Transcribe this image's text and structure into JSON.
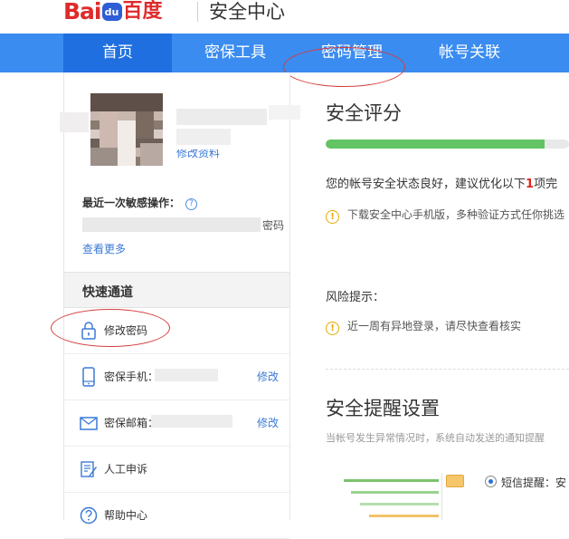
{
  "header": {
    "logo_bai": "Bai",
    "logo_du": "du",
    "logo_cn": "百度",
    "title": "安全中心"
  },
  "nav": {
    "items": [
      {
        "label": "首页",
        "active": true
      },
      {
        "label": "密保工具",
        "active": false
      },
      {
        "label": "密码管理",
        "active": false
      },
      {
        "label": "帐号关联",
        "active": false
      }
    ]
  },
  "sidebar": {
    "edit_profile": "修改资料",
    "recent_label": "最近一次敏感操作：",
    "recent_tail": "密码",
    "see_more": "查看更多",
    "quick_title": "快速通道",
    "items": [
      {
        "icon": "lock-icon",
        "label": "修改密码"
      },
      {
        "icon": "phone-icon",
        "label": "密保手机：",
        "action": "修改"
      },
      {
        "icon": "mail-icon",
        "label": "密保邮箱：",
        "action": "修改"
      },
      {
        "icon": "appeal-icon",
        "label": "人工申诉"
      },
      {
        "icon": "help-icon",
        "label": "帮助中心"
      }
    ]
  },
  "main": {
    "score_title": "安全评分",
    "score_progress": 0.9,
    "status_prefix": "您的帐号安全状态良好，建议优化以下",
    "status_count": "1",
    "status_suffix": "项完",
    "tip_download": "下载安全中心手机版，多种验证方式任你挑选",
    "risk_label": "风险提示：",
    "tip_risk": "近一周有异地登录，请尽快查看核实",
    "remind_title": "安全提醒设置",
    "remind_sub": "当帐号发生异常情况时，系统自动发送的通知提醒",
    "sms_label": "短信提醒：安"
  },
  "colors": {
    "nav_bg": "#3b8cf0",
    "nav_active": "#1f6fe0",
    "link": "#3b7ad6",
    "progress": "#62c462",
    "warning": "#e8a900",
    "annotation": "#d43d3d"
  }
}
